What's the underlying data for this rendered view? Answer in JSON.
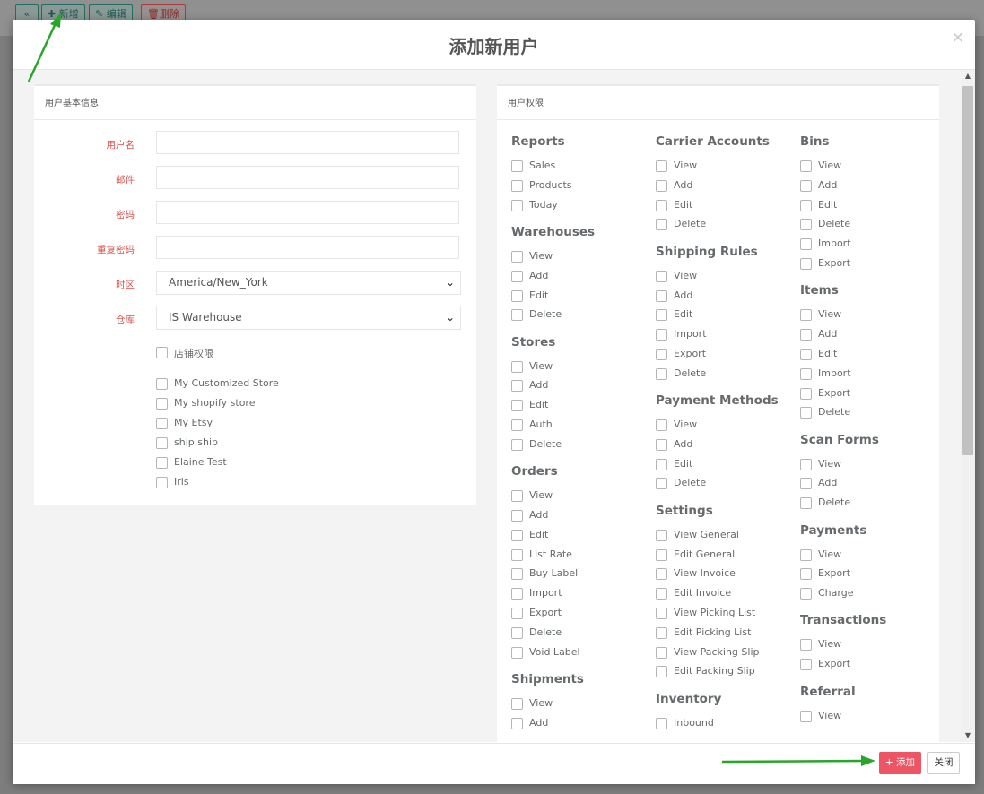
{
  "background_toolbar": {
    "collapse_icon": "«",
    "new_label": "新增",
    "edit_label": "编辑",
    "delete_label": "删除"
  },
  "modal": {
    "title": "添加新用户",
    "close_icon": "×"
  },
  "basic_info": {
    "heading": "用户基本信息",
    "fields": {
      "username_label": "用户名",
      "email_label": "邮件",
      "password_label": "密码",
      "repeat_password_label": "重复密码",
      "timezone_label": "时区",
      "timezone_value": "America/New_York",
      "warehouse_label": "仓库",
      "warehouse_value": "IS Warehouse"
    },
    "store_permission_label": "店铺权限",
    "stores": [
      "My Customized Store",
      "My shopify store",
      "My Etsy",
      "ship ship",
      "Elaine Test",
      "Iris"
    ]
  },
  "permissions": {
    "heading": "用户权限",
    "columns": [
      [
        {
          "title": "Reports",
          "items": [
            "Sales",
            "Products",
            "Today"
          ]
        },
        {
          "title": "Warehouses",
          "items": [
            "View",
            "Add",
            "Edit",
            "Delete"
          ]
        },
        {
          "title": "Stores",
          "items": [
            "View",
            "Add",
            "Edit",
            "Auth",
            "Delete"
          ]
        },
        {
          "title": "Orders",
          "items": [
            "View",
            "Add",
            "Edit",
            "List Rate",
            "Buy Label",
            "Import",
            "Export",
            "Delete",
            "Void Label"
          ]
        },
        {
          "title": "Shipments",
          "items": [
            "View",
            "Add"
          ]
        }
      ],
      [
        {
          "title": "Carrier Accounts",
          "items": [
            "View",
            "Add",
            "Edit",
            "Delete"
          ]
        },
        {
          "title": "Shipping Rules",
          "items": [
            "View",
            "Add",
            "Edit",
            "Import",
            "Export",
            "Delete"
          ]
        },
        {
          "title": "Payment Methods",
          "items": [
            "View",
            "Add",
            "Edit",
            "Delete"
          ]
        },
        {
          "title": "Settings",
          "items": [
            "View General",
            "Edit General",
            "View Invoice",
            "Edit Invoice",
            "View Picking List",
            "Edit Picking List",
            "View Packing Slip",
            "Edit Packing Slip"
          ]
        },
        {
          "title": "Inventory",
          "items": [
            "Inbound"
          ]
        }
      ],
      [
        {
          "title": "Bins",
          "items": [
            "View",
            "Add",
            "Edit",
            "Delete",
            "Import",
            "Export"
          ]
        },
        {
          "title": "Items",
          "items": [
            "View",
            "Add",
            "Edit",
            "Import",
            "Export",
            "Delete"
          ]
        },
        {
          "title": "Scan Forms",
          "items": [
            "View",
            "Add",
            "Delete"
          ]
        },
        {
          "title": "Payments",
          "items": [
            "View",
            "Export",
            "Charge"
          ]
        },
        {
          "title": "Transactions",
          "items": [
            "View",
            "Export"
          ]
        },
        {
          "title": "Referral",
          "items": [
            "View"
          ]
        }
      ]
    ]
  },
  "footer": {
    "add_label": "+ 添加",
    "close_label": "关闭"
  },
  "colors": {
    "required_label": "#d9534f",
    "add_button": "#ed5565",
    "annotation_arrow": "#2aa52a"
  }
}
